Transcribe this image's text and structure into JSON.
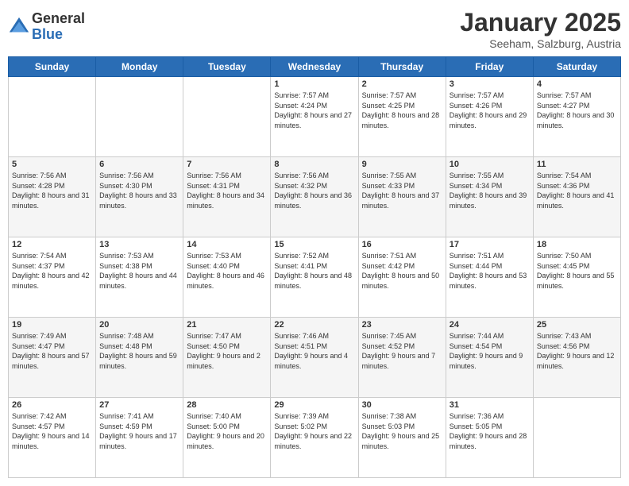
{
  "logo": {
    "general": "General",
    "blue": "Blue"
  },
  "header": {
    "month": "January 2025",
    "location": "Seeham, Salzburg, Austria"
  },
  "weekdays": [
    "Sunday",
    "Monday",
    "Tuesday",
    "Wednesday",
    "Thursday",
    "Friday",
    "Saturday"
  ],
  "weeks": [
    [
      {
        "day": "",
        "info": ""
      },
      {
        "day": "",
        "info": ""
      },
      {
        "day": "",
        "info": ""
      },
      {
        "day": "1",
        "info": "Sunrise: 7:57 AM\nSunset: 4:24 PM\nDaylight: 8 hours and 27 minutes."
      },
      {
        "day": "2",
        "info": "Sunrise: 7:57 AM\nSunset: 4:25 PM\nDaylight: 8 hours and 28 minutes."
      },
      {
        "day": "3",
        "info": "Sunrise: 7:57 AM\nSunset: 4:26 PM\nDaylight: 8 hours and 29 minutes."
      },
      {
        "day": "4",
        "info": "Sunrise: 7:57 AM\nSunset: 4:27 PM\nDaylight: 8 hours and 30 minutes."
      }
    ],
    [
      {
        "day": "5",
        "info": "Sunrise: 7:56 AM\nSunset: 4:28 PM\nDaylight: 8 hours and 31 minutes."
      },
      {
        "day": "6",
        "info": "Sunrise: 7:56 AM\nSunset: 4:30 PM\nDaylight: 8 hours and 33 minutes."
      },
      {
        "day": "7",
        "info": "Sunrise: 7:56 AM\nSunset: 4:31 PM\nDaylight: 8 hours and 34 minutes."
      },
      {
        "day": "8",
        "info": "Sunrise: 7:56 AM\nSunset: 4:32 PM\nDaylight: 8 hours and 36 minutes."
      },
      {
        "day": "9",
        "info": "Sunrise: 7:55 AM\nSunset: 4:33 PM\nDaylight: 8 hours and 37 minutes."
      },
      {
        "day": "10",
        "info": "Sunrise: 7:55 AM\nSunset: 4:34 PM\nDaylight: 8 hours and 39 minutes."
      },
      {
        "day": "11",
        "info": "Sunrise: 7:54 AM\nSunset: 4:36 PM\nDaylight: 8 hours and 41 minutes."
      }
    ],
    [
      {
        "day": "12",
        "info": "Sunrise: 7:54 AM\nSunset: 4:37 PM\nDaylight: 8 hours and 42 minutes."
      },
      {
        "day": "13",
        "info": "Sunrise: 7:53 AM\nSunset: 4:38 PM\nDaylight: 8 hours and 44 minutes."
      },
      {
        "day": "14",
        "info": "Sunrise: 7:53 AM\nSunset: 4:40 PM\nDaylight: 8 hours and 46 minutes."
      },
      {
        "day": "15",
        "info": "Sunrise: 7:52 AM\nSunset: 4:41 PM\nDaylight: 8 hours and 48 minutes."
      },
      {
        "day": "16",
        "info": "Sunrise: 7:51 AM\nSunset: 4:42 PM\nDaylight: 8 hours and 50 minutes."
      },
      {
        "day": "17",
        "info": "Sunrise: 7:51 AM\nSunset: 4:44 PM\nDaylight: 8 hours and 53 minutes."
      },
      {
        "day": "18",
        "info": "Sunrise: 7:50 AM\nSunset: 4:45 PM\nDaylight: 8 hours and 55 minutes."
      }
    ],
    [
      {
        "day": "19",
        "info": "Sunrise: 7:49 AM\nSunset: 4:47 PM\nDaylight: 8 hours and 57 minutes."
      },
      {
        "day": "20",
        "info": "Sunrise: 7:48 AM\nSunset: 4:48 PM\nDaylight: 8 hours and 59 minutes."
      },
      {
        "day": "21",
        "info": "Sunrise: 7:47 AM\nSunset: 4:50 PM\nDaylight: 9 hours and 2 minutes."
      },
      {
        "day": "22",
        "info": "Sunrise: 7:46 AM\nSunset: 4:51 PM\nDaylight: 9 hours and 4 minutes."
      },
      {
        "day": "23",
        "info": "Sunrise: 7:45 AM\nSunset: 4:52 PM\nDaylight: 9 hours and 7 minutes."
      },
      {
        "day": "24",
        "info": "Sunrise: 7:44 AM\nSunset: 4:54 PM\nDaylight: 9 hours and 9 minutes."
      },
      {
        "day": "25",
        "info": "Sunrise: 7:43 AM\nSunset: 4:56 PM\nDaylight: 9 hours and 12 minutes."
      }
    ],
    [
      {
        "day": "26",
        "info": "Sunrise: 7:42 AM\nSunset: 4:57 PM\nDaylight: 9 hours and 14 minutes."
      },
      {
        "day": "27",
        "info": "Sunrise: 7:41 AM\nSunset: 4:59 PM\nDaylight: 9 hours and 17 minutes."
      },
      {
        "day": "28",
        "info": "Sunrise: 7:40 AM\nSunset: 5:00 PM\nDaylight: 9 hours and 20 minutes."
      },
      {
        "day": "29",
        "info": "Sunrise: 7:39 AM\nSunset: 5:02 PM\nDaylight: 9 hours and 22 minutes."
      },
      {
        "day": "30",
        "info": "Sunrise: 7:38 AM\nSunset: 5:03 PM\nDaylight: 9 hours and 25 minutes."
      },
      {
        "day": "31",
        "info": "Sunrise: 7:36 AM\nSunset: 5:05 PM\nDaylight: 9 hours and 28 minutes."
      },
      {
        "day": "",
        "info": ""
      }
    ]
  ]
}
